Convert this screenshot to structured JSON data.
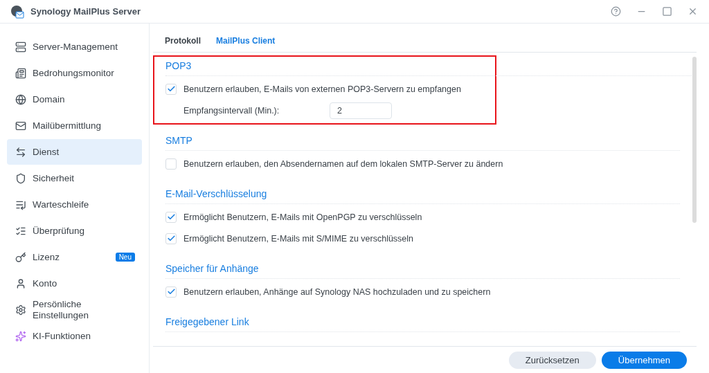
{
  "window": {
    "title": "Synology MailPlus Server"
  },
  "sidebar": {
    "items": [
      {
        "label": "Server-Management",
        "selected": false
      },
      {
        "label": "Bedrohungsmonitor",
        "selected": false
      },
      {
        "label": "Domain",
        "selected": false
      },
      {
        "label": "Mailübermittlung",
        "selected": false
      },
      {
        "label": "Dienst",
        "selected": true
      },
      {
        "label": "Sicherheit",
        "selected": false
      },
      {
        "label": "Warteschleife",
        "selected": false
      },
      {
        "label": "Überprüfung",
        "selected": false
      },
      {
        "label": "Lizenz",
        "selected": false,
        "badge": "Neu"
      },
      {
        "label": "Konto",
        "selected": false
      },
      {
        "label": "Persönliche Einstellungen",
        "selected": false
      },
      {
        "label": "KI-Funktionen",
        "selected": false
      }
    ]
  },
  "tabs": [
    {
      "label": "Protokoll",
      "selected": false
    },
    {
      "label": "MailPlus Client",
      "selected": true
    }
  ],
  "sections": [
    {
      "title": "POP3",
      "highlighted": true,
      "rows": [
        {
          "kind": "checkbox",
          "label": "Benutzern erlauben, E-Mails von externen POP3-Servern zu empfangen",
          "checked": true
        },
        {
          "kind": "field",
          "label": "Empfangsintervall (Min.):",
          "value": "2"
        }
      ]
    },
    {
      "title": "SMTP",
      "highlighted": false,
      "rows": [
        {
          "kind": "checkbox",
          "label": "Benutzern erlauben, den Absendernamen auf dem lokalen SMTP-Server zu ändern",
          "checked": false
        }
      ]
    },
    {
      "title": "E-Mail-Verschlüsselung",
      "highlighted": false,
      "rows": [
        {
          "kind": "checkbox",
          "label": "Ermöglicht Benutzern, E-Mails mit OpenPGP zu verschlüsseln",
          "checked": true
        },
        {
          "kind": "checkbox",
          "label": "Ermöglicht Benutzern, E-Mails mit S/MIME zu verschlüsseln",
          "checked": true
        }
      ]
    },
    {
      "title": "Speicher für Anhänge",
      "highlighted": false,
      "rows": [
        {
          "kind": "checkbox",
          "label": "Benutzern erlauben, Anhänge auf Synology NAS hochzuladen und zu speichern",
          "checked": true
        }
      ]
    },
    {
      "title": "Freigegebener Link",
      "highlighted": false
    }
  ],
  "buttons": [
    {
      "label": "Zurücksetzen",
      "kind": "secondary"
    },
    {
      "label": "Übernehmen",
      "kind": "primary"
    }
  ]
}
